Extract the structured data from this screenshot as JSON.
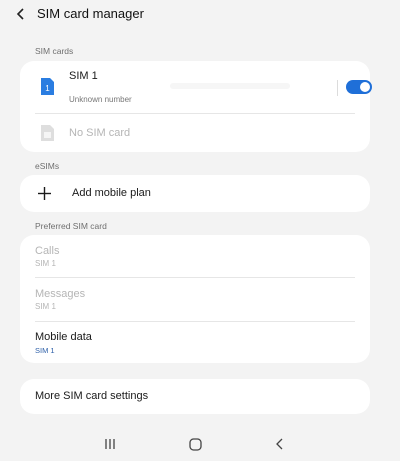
{
  "header": {
    "title": "SIM card manager"
  },
  "sections": {
    "sim_cards": "SIM cards",
    "esims": "eSIMs",
    "preferred": "Preferred SIM card"
  },
  "sim1": {
    "badge": "1",
    "label": "SIM 1",
    "sub": "Unknown number",
    "enabled": true
  },
  "sim2": {
    "label": "No SIM card"
  },
  "add_plan": {
    "label": "Add mobile plan"
  },
  "preferred": {
    "calls": {
      "label": "Calls",
      "value": "SIM 1"
    },
    "messages": {
      "label": "Messages",
      "value": "SIM 1"
    },
    "mobile_data": {
      "label": "Mobile data",
      "value": "SIM 1"
    }
  },
  "more_settings": {
    "label": "More SIM card settings"
  },
  "colors": {
    "accent": "#1f6fd8",
    "sim_icon": "#2a7de1",
    "background": "#f3f3f3"
  },
  "icons": [
    "back-arrow-icon",
    "sim-card-icon",
    "plus-icon",
    "recent-apps-icon",
    "home-icon",
    "back-nav-icon"
  ]
}
